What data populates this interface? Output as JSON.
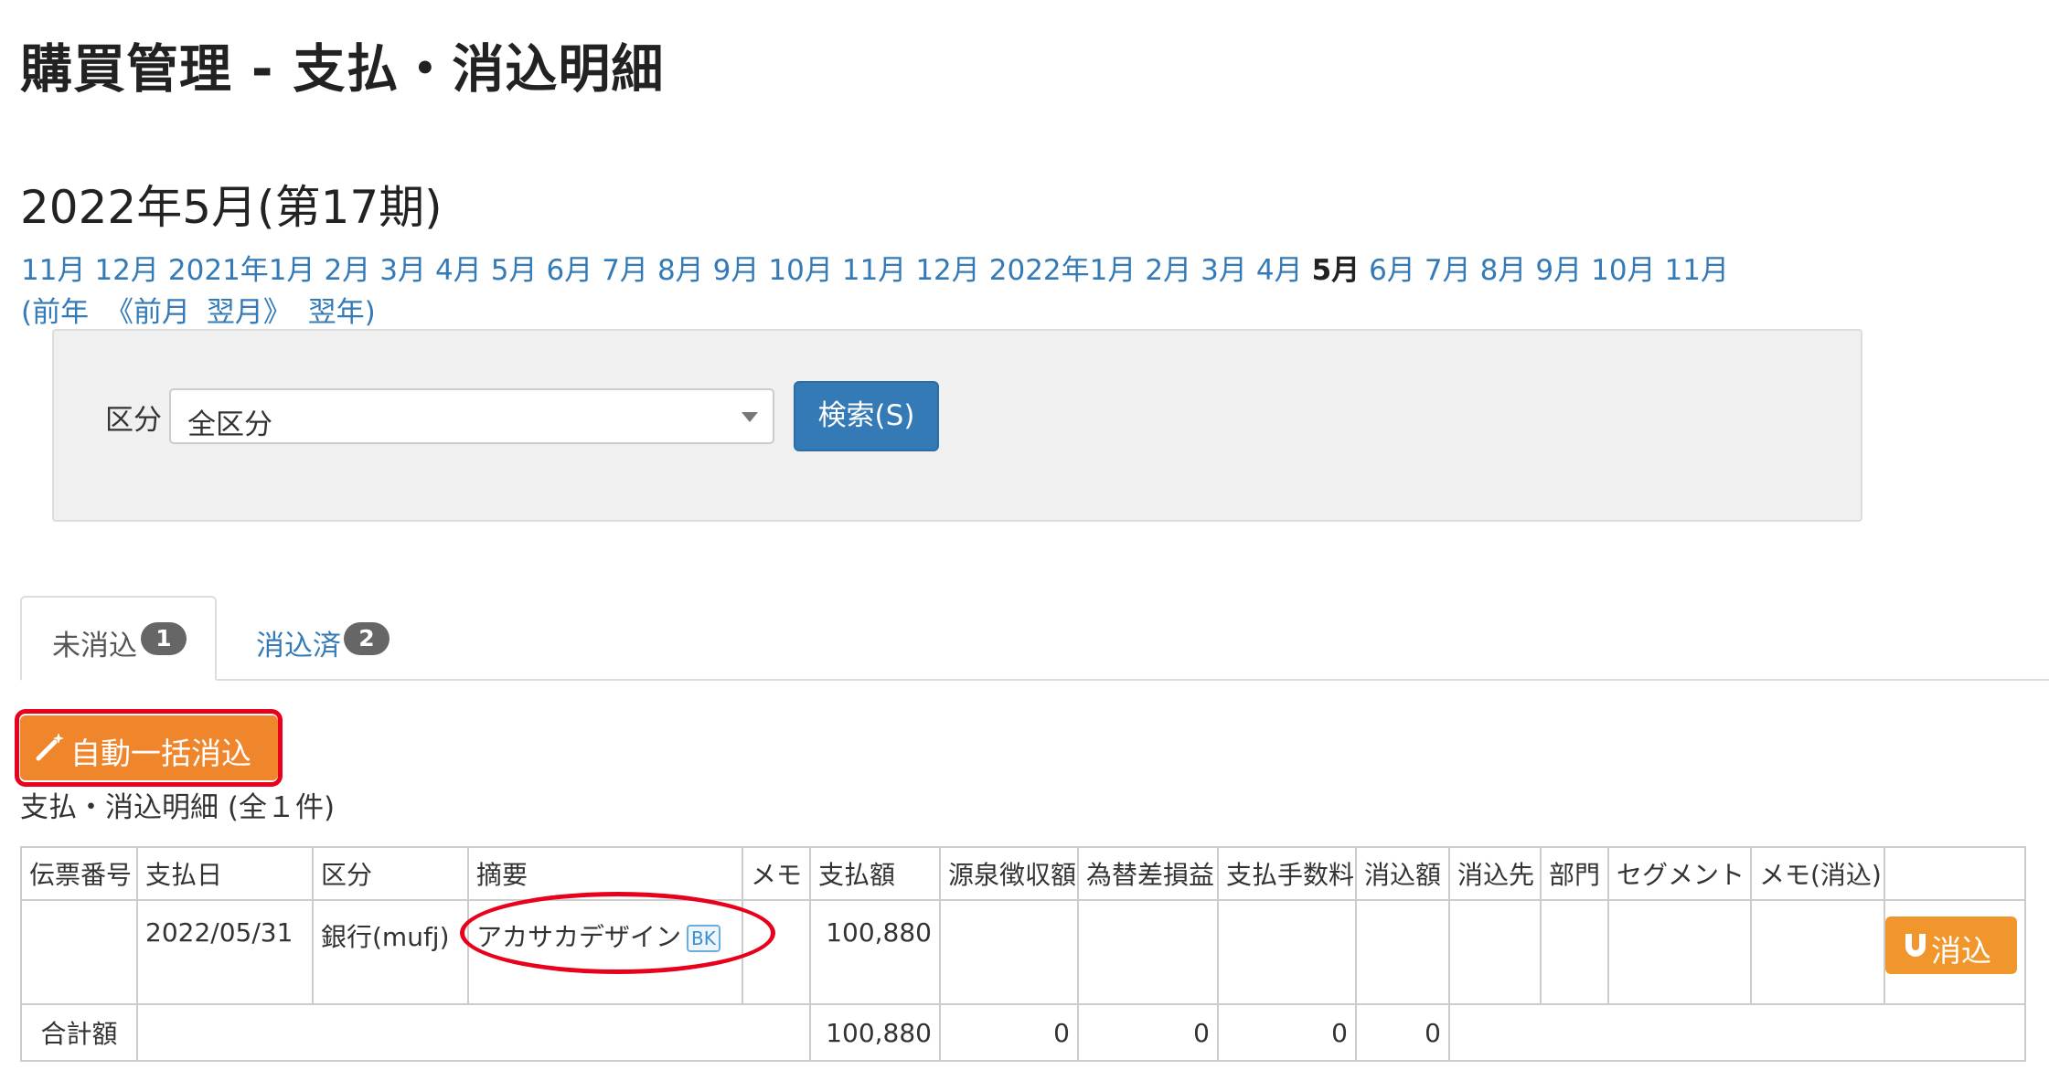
{
  "page": {
    "title": "購買管理 - 支払・消込明細",
    "period_title": "2022年5月(第17期)"
  },
  "month_nav": {
    "items": [
      "11月",
      "12月",
      "2021年1月",
      "2月",
      "3月",
      "4月",
      "5月",
      "6月",
      "7月",
      "8月",
      "9月",
      "10月",
      "11月",
      "12月",
      "2022年1月",
      "2月",
      "3月",
      "4月",
      "5月",
      "6月",
      "7月",
      "8月",
      "9月",
      "10月",
      "11月"
    ],
    "current_index": 18,
    "prev_year": "(前年",
    "prev_month": "《前月",
    "next_month": "翌月》",
    "next_year": "翌年)"
  },
  "search": {
    "category_label": "区分",
    "category_value": "全区分",
    "search_button": "検索(S)"
  },
  "tabs": [
    {
      "label": "未消込",
      "count": "1",
      "active": true
    },
    {
      "label": "消込済",
      "count": "2",
      "active": false
    }
  ],
  "actions": {
    "auto_reconcile_button": "自動一括消込",
    "highlight_color": "#e8001c",
    "button_color": "#f0862c"
  },
  "list": {
    "caption": "支払・消込明細 (全１件)",
    "columns": [
      "伝票番号",
      "支払日",
      "区分",
      "摘要",
      "メモ",
      "支払額",
      "源泉徴収額",
      "為替差損益",
      "支払手数料",
      "消込額",
      "消込先",
      "部門",
      "セグメント",
      "メモ(消込)",
      ""
    ],
    "rows": [
      {
        "voucher_no": "",
        "payment_date": "2022/05/31",
        "category": "銀行(mufj)",
        "description": "アカサカデザイン",
        "description_badge": "BK",
        "memo": "",
        "amount": "100,880",
        "withholding": "",
        "fx_gain_loss": "",
        "fee": "",
        "reconciled": "",
        "reconcile_target": "",
        "department": "",
        "segment": "",
        "memo_reconcile": "",
        "action_label": "消込"
      }
    ],
    "totals": {
      "label": "合計額",
      "amount": "100,880",
      "withholding": "0",
      "fx_gain_loss": "0",
      "fee": "0",
      "reconciled": "0"
    }
  }
}
